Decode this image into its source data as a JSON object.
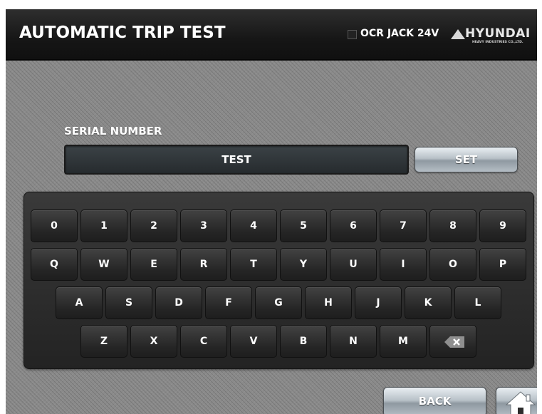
{
  "header": {
    "title": "AUTOMATIC TRIP TEST",
    "status_label": "OCR JACK 24V",
    "logo": {
      "name": "HYUNDAI",
      "subtitle": "HEAVY INDUSTRIES CO.,LTD."
    }
  },
  "serial": {
    "label": "SERIAL NUMBER",
    "value": "TEST",
    "set_label": "SET"
  },
  "keyboard": {
    "rows": [
      [
        "0",
        "1",
        "2",
        "3",
        "4",
        "5",
        "6",
        "7",
        "8",
        "9"
      ],
      [
        "Q",
        "W",
        "E",
        "R",
        "T",
        "Y",
        "U",
        "I",
        "O",
        "P"
      ],
      [
        "A",
        "S",
        "D",
        "F",
        "G",
        "H",
        "J",
        "K",
        "L"
      ],
      [
        "Z",
        "X",
        "C",
        "V",
        "B",
        "N",
        "M"
      ]
    ],
    "backspace_icon": "backspace-icon"
  },
  "footer": {
    "back_label": "BACK",
    "home_icon": "home-icon"
  },
  "colors": {
    "background": "#8a8a8a",
    "header": "#161616",
    "field": "#2f3538",
    "key": "#2a2a2a",
    "button": "#b7c0c7"
  }
}
